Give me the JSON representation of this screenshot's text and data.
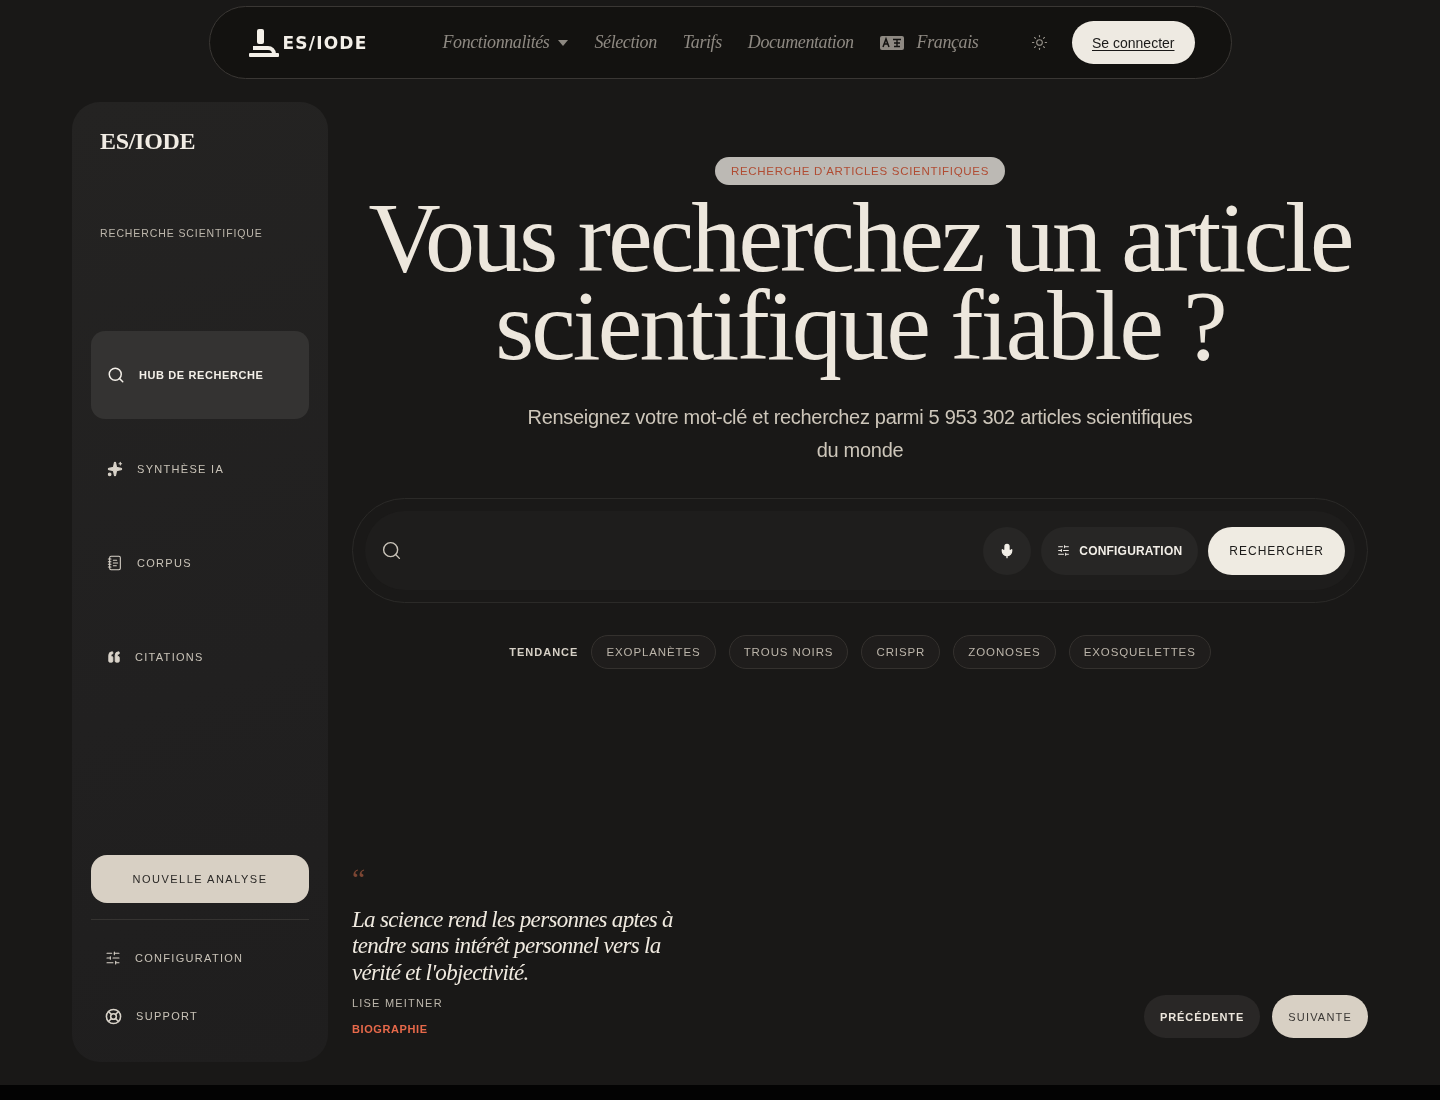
{
  "nav": {
    "logo": "ES/IODE",
    "links": [
      {
        "label": "Fonctionnalités",
        "dropdown": true
      },
      {
        "label": "Sélection",
        "dropdown": false
      },
      {
        "label": "Tarifs",
        "dropdown": false
      },
      {
        "label": "Documentation",
        "dropdown": false
      }
    ],
    "language": "Français",
    "login": "Se connecter"
  },
  "sidebar": {
    "brand": "ES/IODE",
    "section": "RECHERCHE SCIENTIFIQUE",
    "items": [
      {
        "label": "HUB DE RECHERCHE",
        "selected": true
      },
      {
        "label": "SYNTHÈSE IA",
        "selected": false
      },
      {
        "label": "CORPUS",
        "selected": false
      },
      {
        "label": "CITATIONS",
        "selected": false
      }
    ],
    "new_button": "NOUVELLE ANALYSE",
    "footer_items": [
      {
        "label": "CONFIGURATION"
      },
      {
        "label": "SUPPORT"
      }
    ]
  },
  "hero": {
    "badge": "RECHERCHE D’ARTICLES SCIENTIFIQUES",
    "title": "Vous recherchez un article scientifique fiable ?",
    "subtitle": "Renseignez votre mot-clé et recherchez parmi 5 953 302 articles scientifiques du monde"
  },
  "search": {
    "config_button": "CONFIGURATION",
    "submit_button": "RECHERCHER"
  },
  "trending": {
    "label": "TENDANCE",
    "tags": [
      "EXOPLANÈTES",
      "TROUS NOIRS",
      "CRISPR",
      "ZOONOSES",
      "EXOSQUELETTES"
    ]
  },
  "quote": {
    "mark": "“",
    "text": "La science rend les personnes aptes à tendre sans intérêt personnel vers la vérité et l'objectivité.",
    "author": "LISE MEITNER",
    "link": "BIOGRAPHIE",
    "prev_button": "PRÉCÉDENTE",
    "next_button": "SUIVANTE"
  }
}
